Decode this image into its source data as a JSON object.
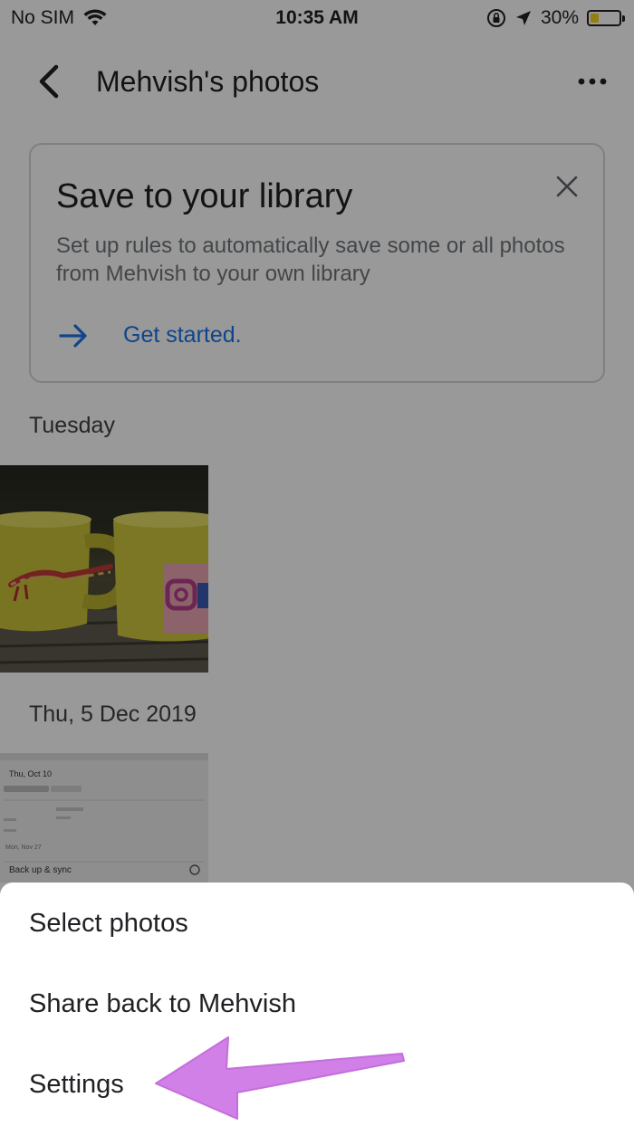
{
  "status_bar": {
    "carrier": "No SIM",
    "time": "10:35 AM",
    "battery": "30%",
    "battery_level": 0.3,
    "icons": [
      "wifi-icon",
      "orientation-lock-icon",
      "location-arrow-icon",
      "battery-icon"
    ]
  },
  "header": {
    "title": "Mehvish's photos",
    "back_icon": "chevron-left-icon",
    "more_icon": "more-horizontal-icon"
  },
  "card": {
    "title": "Save to your library",
    "description": "Set up rules to automatically save some or all photos from Mehvish to your own library",
    "action_label": "Get started.",
    "action_icon": "arrow-right-icon",
    "close_icon": "close-icon"
  },
  "sections": [
    {
      "label": "Tuesday"
    },
    {
      "label": "Thu, 5 Dec 2019"
    }
  ],
  "thumbnail_text": {
    "date": "Thu, Oct 10",
    "second_date": "Mon, Nov 27",
    "backup_label": "Back up & sync"
  },
  "bottom_sheet": {
    "items": [
      {
        "label": "Select photos"
      },
      {
        "label": "Share back to Mehvish"
      },
      {
        "label": "Settings"
      }
    ]
  },
  "colors": {
    "accent": "#1a73e8",
    "pointer_arrow": "#d080e6",
    "battery_fill": "#f7d21a"
  }
}
